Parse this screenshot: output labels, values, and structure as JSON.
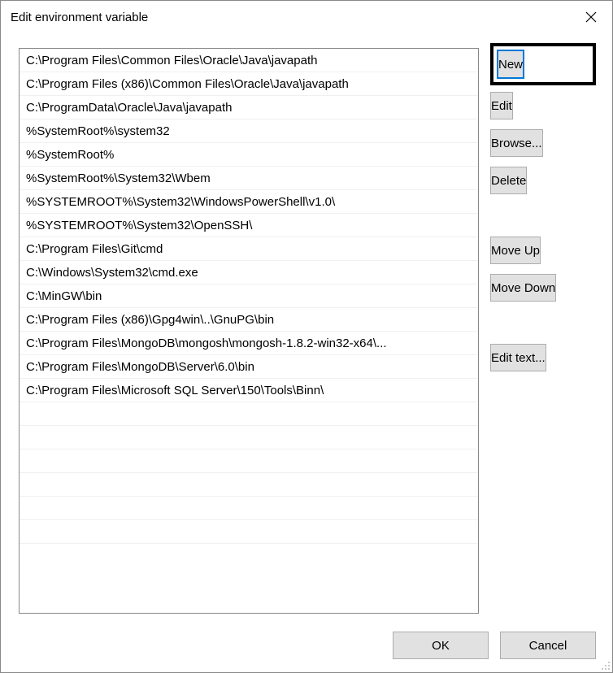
{
  "window": {
    "title": "Edit environment variable"
  },
  "paths": [
    "C:\\Program Files\\Common Files\\Oracle\\Java\\javapath",
    "C:\\Program Files (x86)\\Common Files\\Oracle\\Java\\javapath",
    "C:\\ProgramData\\Oracle\\Java\\javapath",
    "%SystemRoot%\\system32",
    "%SystemRoot%",
    "%SystemRoot%\\System32\\Wbem",
    "%SYSTEMROOT%\\System32\\WindowsPowerShell\\v1.0\\",
    "%SYSTEMROOT%\\System32\\OpenSSH\\",
    "C:\\Program Files\\Git\\cmd",
    "C:\\Windows\\System32\\cmd.exe",
    "C:\\MinGW\\bin",
    "C:\\Program Files (x86)\\Gpg4win\\..\\GnuPG\\bin",
    "C:\\Program Files\\MongoDB\\mongosh\\mongosh-1.8.2-win32-x64\\...",
    "C:\\Program Files\\MongoDB\\Server\\6.0\\bin",
    "C:\\Program Files\\Microsoft SQL Server\\150\\Tools\\Binn\\"
  ],
  "buttons": {
    "new": "New",
    "edit": "Edit",
    "browse": "Browse...",
    "delete": "Delete",
    "moveUp": "Move Up",
    "moveDown": "Move Down",
    "editText": "Edit text...",
    "ok": "OK",
    "cancel": "Cancel"
  }
}
